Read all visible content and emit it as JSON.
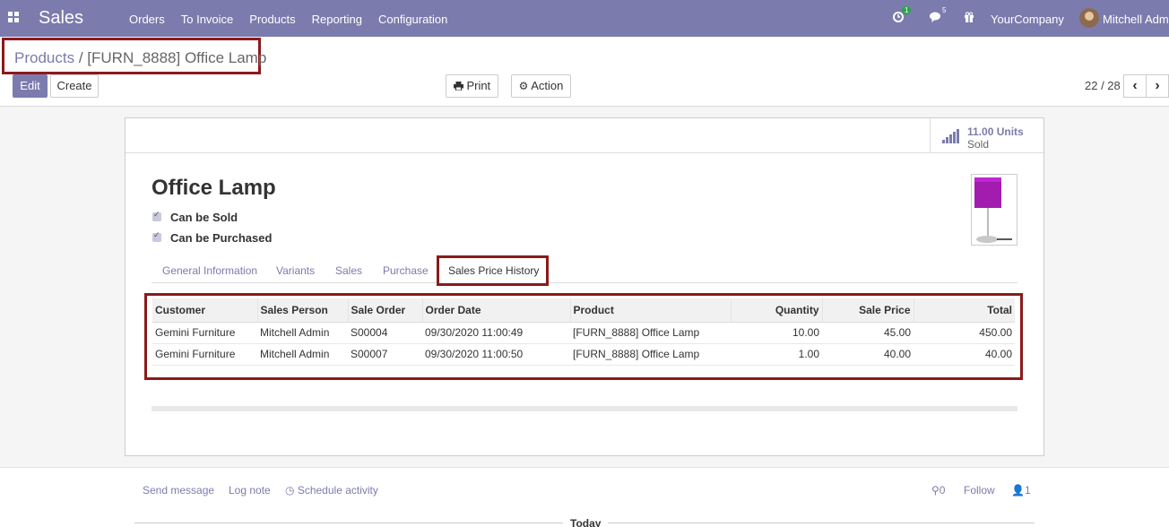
{
  "navbar": {
    "app_title": "Sales",
    "menu": [
      "Orders",
      "To Invoice",
      "Products",
      "Reporting",
      "Configuration"
    ],
    "activity_count": "1",
    "message_count": "5",
    "company": "YourCompany",
    "user": "Mitchell Admin",
    "colors": {
      "brand": "#7c7bad",
      "badge": "#28a745"
    }
  },
  "breadcrumb": {
    "parent": "Products",
    "separator": "/",
    "current": "[FURN_8888] Office Lamp"
  },
  "toolbar": {
    "edit": "Edit",
    "create": "Create",
    "print": "Print",
    "action": "Action"
  },
  "pager": {
    "value": "22 / 28"
  },
  "stat": {
    "value": "11.00 Units",
    "label": "Sold"
  },
  "product": {
    "name": "Office Lamp",
    "can_be_sold": "Can be Sold",
    "can_be_purchased": "Can be Purchased"
  },
  "tabs": [
    "General Information",
    "Variants",
    "Sales",
    "Purchase",
    "Sales Price History"
  ],
  "history": {
    "columns": [
      "Customer",
      "Sales Person",
      "Sale Order",
      "Order Date",
      "Product",
      "Quantity",
      "Sale Price",
      "Total"
    ],
    "rows": [
      [
        "Gemini Furniture",
        "Mitchell Admin",
        "S00004",
        "09/30/2020 11:00:49",
        "[FURN_8888] Office Lamp",
        "10.00",
        "45.00",
        "450.00"
      ],
      [
        "Gemini Furniture",
        "Mitchell Admin",
        "S00007",
        "09/30/2020 11:00:50",
        "[FURN_8888] Office Lamp",
        "1.00",
        "40.00",
        "40.00"
      ]
    ]
  },
  "chatter": {
    "send_message": "Send message",
    "log_note": "Log note",
    "schedule_activity": "Schedule activity",
    "attachments": "0",
    "follow": "Follow",
    "followers": "1",
    "today": "Today"
  }
}
